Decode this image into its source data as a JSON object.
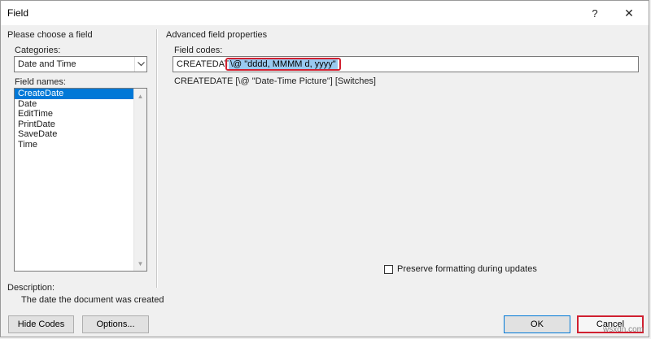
{
  "window": {
    "title": "Field",
    "help_glyph": "?",
    "close_glyph": "✕"
  },
  "left": {
    "group_label": "Please choose a field",
    "categories_label": "Categories:",
    "category_selected": "Date and Time",
    "field_names_label": "Field names:",
    "field_names": [
      "CreateDate",
      "Date",
      "EditTime",
      "PrintDate",
      "SaveDate",
      "Time"
    ],
    "selected_index": 0
  },
  "right": {
    "group_label": "Advanced field properties",
    "field_codes_label": "Field codes:",
    "field_code_prefix": "CREATEDATE",
    "field_code_switch": "\\@ \"dddd, MMMM d, yyyy\"",
    "syntax_hint": "CREATEDATE [\\@ \"Date-Time Picture\"] [Switches]",
    "preserve_label": "Preserve formatting during updates",
    "preserve_checked": false
  },
  "description": {
    "label": "Description:",
    "text": "The date the document was created"
  },
  "buttons": {
    "hide_codes": "Hide Codes",
    "options": "Options...",
    "ok": "OK",
    "cancel": "Cancel"
  },
  "watermark": "wsxdn.com",
  "colors": {
    "selection": "#0078d7",
    "highlight_border": "#d02030",
    "text_selection": "#99c9ef"
  }
}
